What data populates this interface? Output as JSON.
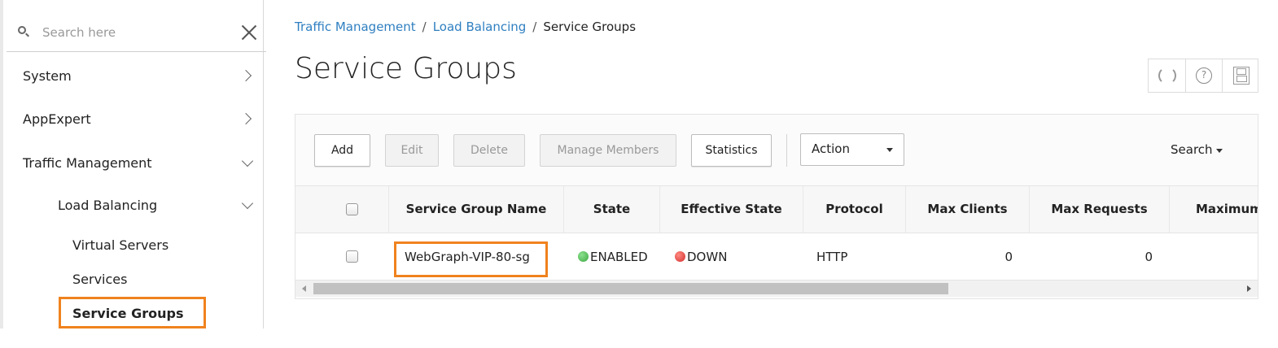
{
  "sidebar": {
    "search_placeholder": "Search here",
    "items": [
      {
        "label": "System"
      },
      {
        "label": "AppExpert"
      },
      {
        "label": "Traffic Management"
      },
      {
        "label": "Load Balancing"
      }
    ],
    "sub_items": [
      {
        "label": "Virtual Servers"
      },
      {
        "label": "Services"
      },
      {
        "label": "Service Groups"
      }
    ]
  },
  "breadcrumb": {
    "items": [
      "Traffic Management",
      "Load Balancing",
      "Service Groups"
    ],
    "separator": "/"
  },
  "page": {
    "title": "Service Groups"
  },
  "header_tools": {
    "help_glyph": "?"
  },
  "toolbar": {
    "add": "Add",
    "edit": "Edit",
    "delete": "Delete",
    "manage_members": "Manage Members",
    "statistics": "Statistics",
    "action_value": "Action",
    "search": "Search"
  },
  "table": {
    "columns": [
      "Service Group Name",
      "State",
      "Effective State",
      "Protocol",
      "Max Clients",
      "Max Requests",
      "Maximum"
    ],
    "rows": [
      {
        "name": "WebGraph-VIP-80-sg",
        "state": "ENABLED",
        "effective_state": "DOWN",
        "protocol": "HTTP",
        "max_clients": "0",
        "max_requests": "0"
      }
    ]
  },
  "colors": {
    "highlight": "#f0821e",
    "link": "#2f7fc1",
    "state_enabled": "#4caf50",
    "state_down": "#e53935"
  },
  "scroll": {
    "horizontal_position_fraction": 0.0,
    "visible_fraction": 0.66
  }
}
